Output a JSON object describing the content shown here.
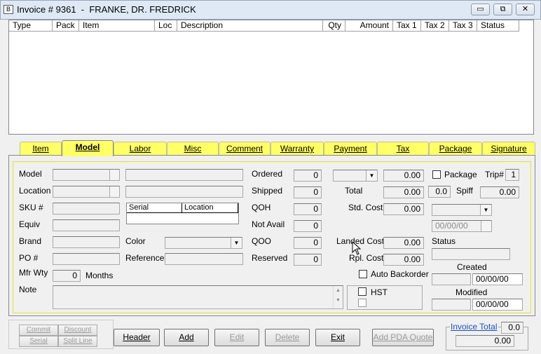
{
  "window": {
    "title": "Invoice # 9361  -  FRANKE, DR. FREDRICK",
    "icon_glyph": "B",
    "min": "▭",
    "restore": "⧉",
    "close": "✕"
  },
  "grid": {
    "columns": [
      "Type",
      "Pack",
      "Item",
      "Loc",
      "Description",
      "Qty",
      "Amount",
      "Tax 1",
      "Tax 2",
      "Tax 3",
      "Status"
    ]
  },
  "tabs": [
    "Item",
    "Model",
    "Labor",
    "Misc",
    "Comment",
    "Warranty",
    "Payment",
    "Tax",
    "Package",
    "Signature"
  ],
  "model_tab": {
    "labels": {
      "model": "Model",
      "location": "Location",
      "sku": "SKU #",
      "equiv": "Equiv",
      "brand": "Brand",
      "po": "PO #",
      "mfr_wty": "Mfr Wty",
      "months": "Months",
      "note": "Note",
      "color": "Color",
      "reference": "Reference",
      "serial": "Serial",
      "location_col": "Location",
      "ordered": "Ordered",
      "shipped": "Shipped",
      "qoh": "QOH",
      "not_avail": "Not Avail",
      "qoo": "QOO",
      "reserved": "Reserved",
      "total": "Total",
      "std_cost": "Std. Cost",
      "landed_cost": "Landed Cost",
      "rpl_cost": "Rpl. Cost",
      "auto_backorder": "Auto Backorder",
      "hst": "HST",
      "package": "Package",
      "trip": "Trip#",
      "spiff": "Spiff",
      "status": "Status",
      "created": "Created",
      "modified": "Modified"
    },
    "values": {
      "mfr_wty": "0",
      "ordered": "0",
      "shipped": "0",
      "qoh": "0",
      "not_avail": "0",
      "qoo": "0",
      "reserved": "0",
      "price": "0.00",
      "total": "0.00",
      "std_cost": "0.00",
      "landed_cost": "0.00",
      "rpl_cost": "0.00",
      "trip": "1",
      "spiff_pct": "0.0",
      "spiff": "0.00",
      "date": "00/00/00",
      "created": "00/00/00",
      "modified": "00/00/00"
    }
  },
  "footer": {
    "commit": "Commit",
    "discount": "Discount",
    "serial": "Serial",
    "split_line": "Split Line",
    "header": "Header",
    "add": "Add",
    "edit": "Edit",
    "delete": "Delete",
    "exit": "Exit",
    "add_pda_quote": "Add PDA Quote",
    "invoice_total_label": "Invoice Total",
    "invoice_total_pct": "0.0",
    "invoice_total": "0.00"
  }
}
